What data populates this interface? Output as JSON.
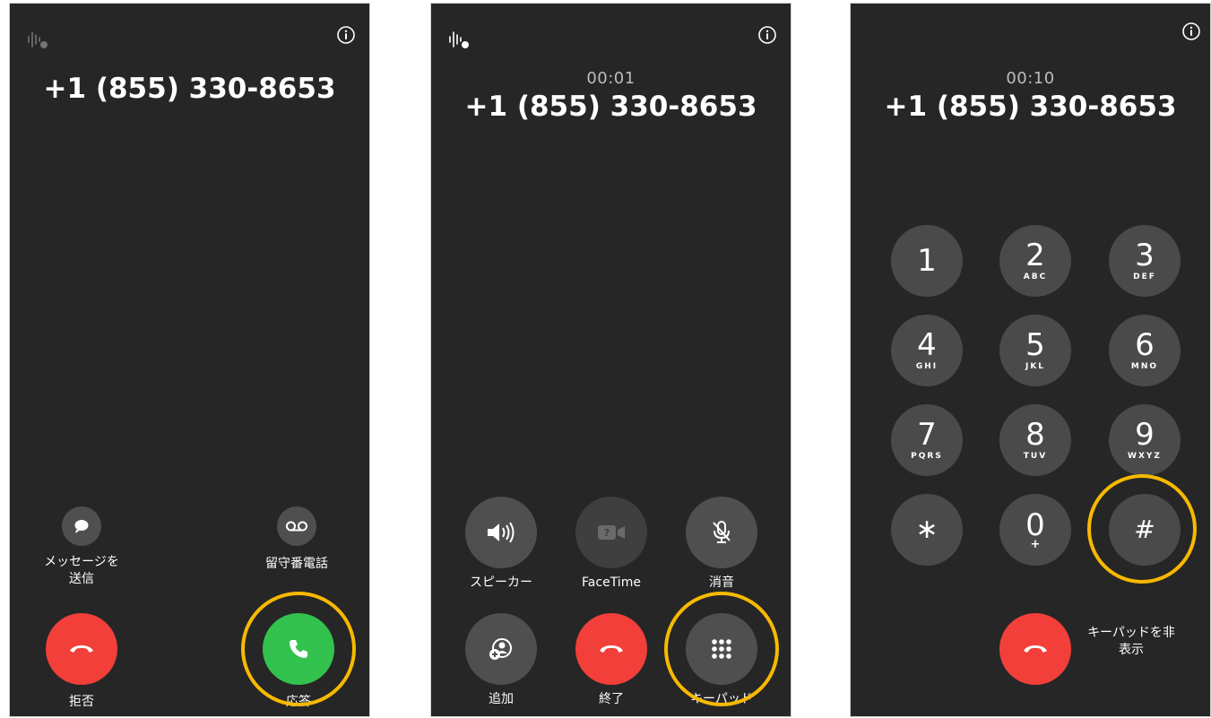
{
  "incoming": {
    "number": "+1 (855) 330-8653",
    "message_label": "メッセージを\n送信",
    "voicemail_label": "留守番電話",
    "decline_label": "拒否",
    "accept_label": "応答"
  },
  "in_call": {
    "timer": "00:01",
    "number": "+1 (855) 330-8653",
    "speaker_label": "スピーカー",
    "facetime_label": "FaceTime",
    "mute_label": "消音",
    "add_label": "追加",
    "end_label": "終了",
    "keypad_label": "キーパッド"
  },
  "keypad": {
    "timer": "00:10",
    "number": "+1 (855) 330-8653",
    "keys": [
      {
        "digit": "1",
        "letters": ""
      },
      {
        "digit": "2",
        "letters": "ABC"
      },
      {
        "digit": "3",
        "letters": "DEF"
      },
      {
        "digit": "4",
        "letters": "GHI"
      },
      {
        "digit": "5",
        "letters": "JKL"
      },
      {
        "digit": "6",
        "letters": "MNO"
      },
      {
        "digit": "7",
        "letters": "PQRS"
      },
      {
        "digit": "8",
        "letters": "TUV"
      },
      {
        "digit": "9",
        "letters": "WXYZ"
      },
      {
        "digit": "∗",
        "letters": ""
      },
      {
        "digit": "0",
        "letters": "+"
      },
      {
        "digit": "#",
        "letters": ""
      }
    ],
    "hide_label": "キーパッドを非\n表示"
  },
  "colors": {
    "background": "#262626",
    "decline_red": "#f23f3a",
    "accept_green": "#33c24d",
    "highlight_ring": "#f7b900"
  }
}
